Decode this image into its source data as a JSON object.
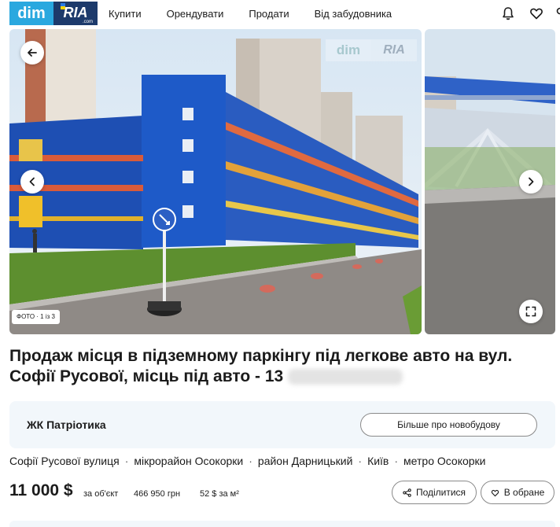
{
  "header": {
    "logo_dim": "dim",
    "logo_ria": "RIA",
    "logo_com": ".com",
    "nav": [
      "Купити",
      "Орендувати",
      "Продати",
      "Від забудовника"
    ]
  },
  "gallery": {
    "watermark_dim": "dim",
    "watermark_ria": "RIA",
    "photo_counter": "ФОТО · 1 із 3"
  },
  "listing": {
    "title": "Продаж місця в підземному паркінгу під легкове авто на вул. Софії Русової, місць під авто - 13"
  },
  "project": {
    "name": "ЖК Патріотика",
    "more_label": "Більше про новобудову"
  },
  "location": [
    "Софії Русової вулиця",
    "мікрорайон Осокорки",
    "район Дарницький",
    "Київ",
    "метро Осокорки"
  ],
  "price": {
    "main": "11 000 $",
    "per_object": "за об'єкт",
    "uah": "466 950 грн",
    "per_m2": "52 $ за м²"
  },
  "actions": {
    "share": "Поділитися",
    "favorite": "В обране"
  }
}
